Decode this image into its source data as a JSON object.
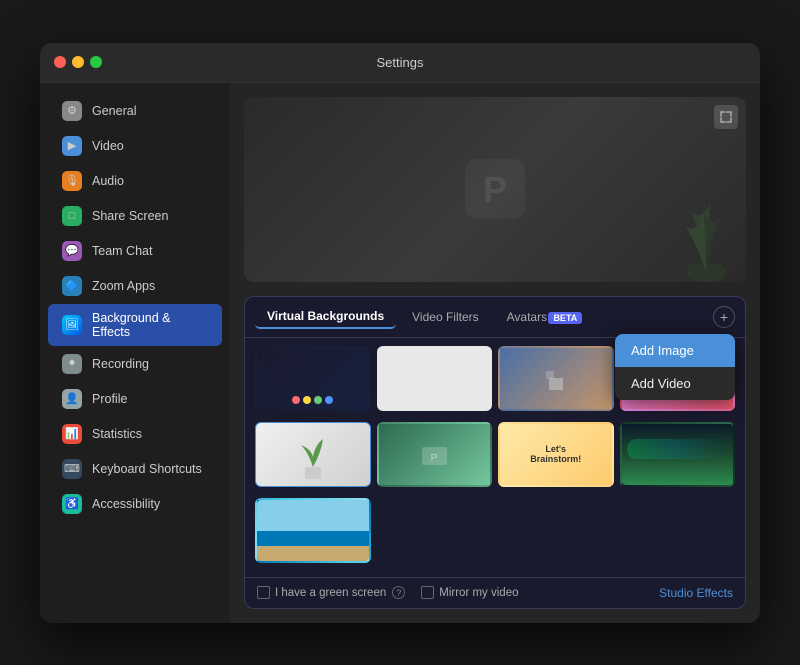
{
  "window": {
    "title": "Settings",
    "traffic": [
      "red",
      "yellow",
      "green"
    ]
  },
  "sidebar": {
    "items": [
      {
        "id": "general",
        "label": "General",
        "iconClass": "icon-general",
        "icon": "⚙"
      },
      {
        "id": "video",
        "label": "Video",
        "iconClass": "icon-video",
        "icon": "📹"
      },
      {
        "id": "audio",
        "label": "Audio",
        "iconClass": "icon-audio",
        "icon": "🎙"
      },
      {
        "id": "share-screen",
        "label": "Share Screen",
        "iconClass": "icon-share",
        "icon": "🖥"
      },
      {
        "id": "team-chat",
        "label": "Team Chat",
        "iconClass": "icon-team",
        "icon": "💬"
      },
      {
        "id": "zoom-apps",
        "label": "Zoom Apps",
        "iconClass": "icon-zoom",
        "icon": "🔷"
      },
      {
        "id": "background",
        "label": "Background & Effects",
        "iconClass": "icon-bg",
        "icon": "🖼",
        "active": true
      },
      {
        "id": "recording",
        "label": "Recording",
        "iconClass": "icon-recording",
        "icon": "⏺"
      },
      {
        "id": "profile",
        "label": "Profile",
        "iconClass": "icon-profile",
        "icon": "👤"
      },
      {
        "id": "statistics",
        "label": "Statistics",
        "iconClass": "icon-stats",
        "icon": "📊"
      },
      {
        "id": "keyboard",
        "label": "Keyboard Shortcuts",
        "iconClass": "icon-keyboard",
        "icon": "⌨"
      },
      {
        "id": "accessibility",
        "label": "Accessibility",
        "iconClass": "icon-accessibility",
        "icon": "♿"
      }
    ]
  },
  "main": {
    "tabs": [
      {
        "id": "virtual-bg",
        "label": "Virtual Backgrounds",
        "active": true
      },
      {
        "id": "video-filters",
        "label": "Video Filters",
        "active": false
      },
      {
        "id": "avatars",
        "label": "Avatars",
        "active": false,
        "beta": true
      }
    ],
    "add_button_label": "+",
    "dropdown": {
      "items": [
        {
          "id": "add-image",
          "label": "Add Image",
          "highlighted": true
        },
        {
          "id": "add-video",
          "label": "Add Video",
          "highlighted": false
        }
      ]
    },
    "backgrounds": [
      {
        "id": "colorful",
        "class": "bg-colorful",
        "selected": false
      },
      {
        "id": "white",
        "class": "bg-white",
        "selected": false
      },
      {
        "id": "room",
        "class": "bg-room",
        "selected": false
      },
      {
        "id": "pink",
        "class": "bg-pink",
        "selected": false
      },
      {
        "id": "plant",
        "class": "bg-plant",
        "selected": true
      },
      {
        "id": "green-office",
        "class": "bg-green-office",
        "selected": false
      },
      {
        "id": "lets",
        "class": "bg-lets",
        "selected": false
      },
      {
        "id": "aurora",
        "class": "bg-aurora",
        "selected": false
      },
      {
        "id": "beach",
        "class": "bg-beach",
        "selected": false
      }
    ],
    "bottom": {
      "green_screen_label": "I have a green screen",
      "mirror_label": "Mirror my video",
      "studio_effects_label": "Studio Effects"
    }
  }
}
